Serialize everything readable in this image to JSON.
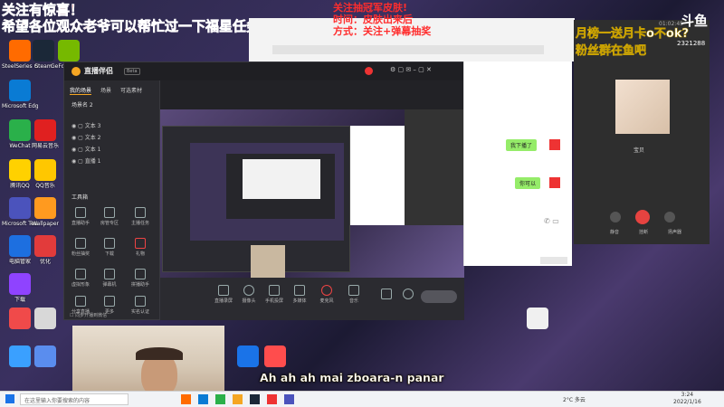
{
  "overlay_left": {
    "line1": "关注有惊喜！",
    "line2": "希望各位观众老爷可以帮忙过一下福星任务"
  },
  "overlay_mid": {
    "line1": "关注抽冠军皮肤!",
    "line2": "时间：皮肤出来后",
    "line3": "方式：关注+弹幕抽奖"
  },
  "overlay_right": {
    "line1": "月榜一送月卡o不ok?",
    "line2": "粉丝群在鱼吧"
  },
  "stream_logo": "斗鱼",
  "room_id": "2321288",
  "desktop_icons": [
    "SteelSeries GG",
    "Steam",
    "GeForce Experience",
    "Microsoft Edge",
    "WeChat",
    "网易云音乐",
    "腾讯QQ",
    "QQ音乐",
    "Microsoft Teams",
    "Wallpaper",
    "电脑管家",
    "优化",
    "下载"
  ],
  "obs": {
    "app_name": "直播伴侣",
    "version": "Beta",
    "tabs": [
      "我的场景",
      "场景",
      "可选素材"
    ],
    "scene_label": "场景名 2",
    "sources": [
      "文本 3",
      "文本 2",
      "文本 1",
      "直播 1"
    ],
    "tools_title": "工具箱",
    "tools": [
      "直播助手",
      "房管专区",
      "主播任务",
      "粉丝抽奖",
      "下载",
      "礼物",
      "虚拟形象",
      "弹幕机",
      "拼播助手",
      "分享直播",
      "更多",
      "实名认证"
    ],
    "checkbox_label": "同步开播到微信",
    "bottom_tools": [
      "直播录屏",
      "摄像头",
      "手机投屏",
      "多媒体",
      "麦克风",
      "音乐",
      "画面",
      "语音",
      "开始直播"
    ]
  },
  "chat": {
    "messages": [
      "我下播了",
      "你可以"
    ]
  },
  "call": {
    "caller": "宝贝",
    "time": "01:02:45",
    "actions": [
      "静音",
      "挂断",
      "扬声器"
    ]
  },
  "subtitle": "Ah ah ah mai zboara-n panar",
  "taskbar": {
    "search_placeholder": "在这里输入你要搜索的内容",
    "temperature": "2°C 多云",
    "time": "3:24",
    "date": "2022/1/16"
  }
}
